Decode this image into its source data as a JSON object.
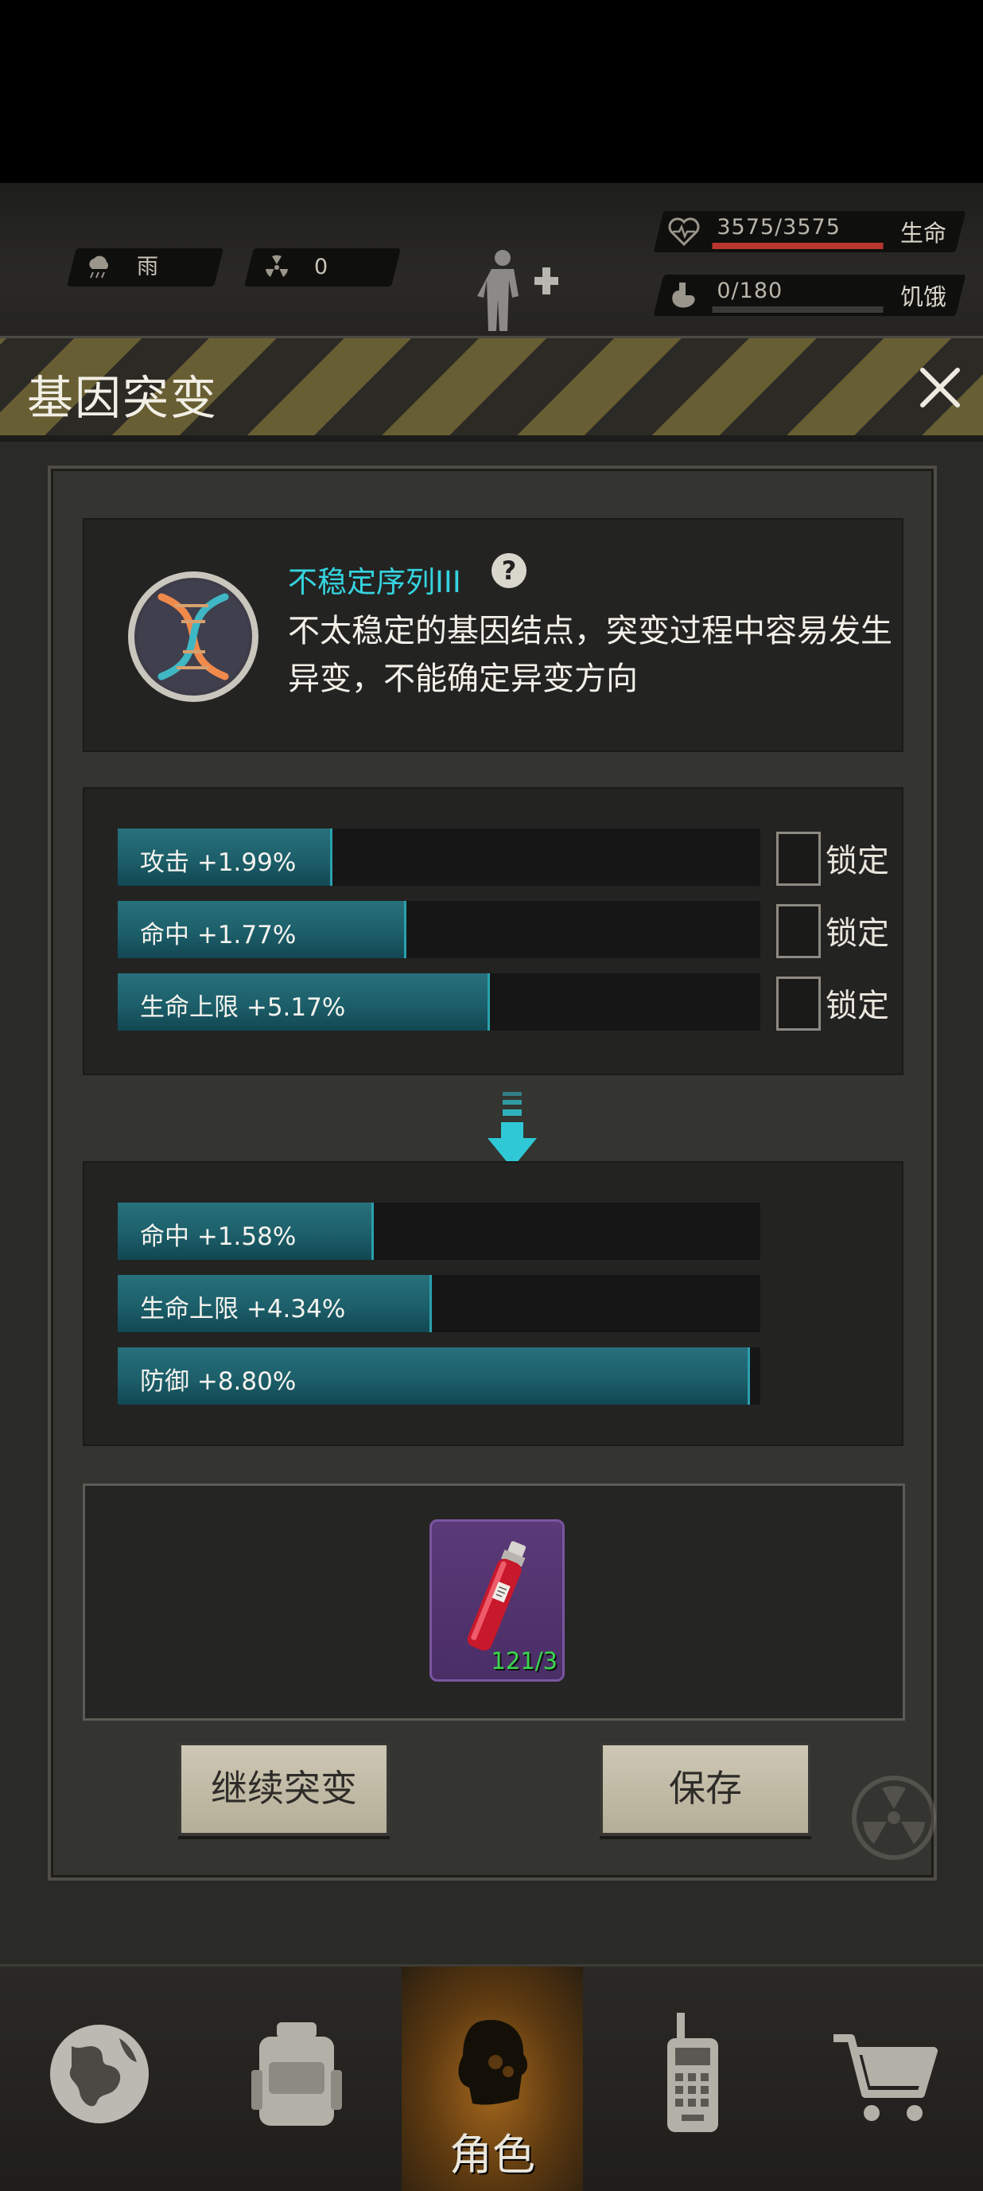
{
  "status": {
    "weather": {
      "icon": "rain-cloud-icon",
      "label": "雨"
    },
    "radiation": {
      "icon": "radiation-icon",
      "value": "0"
    },
    "hp": {
      "value": "3575/3575",
      "label": "生命",
      "fill": 1.0
    },
    "hunger": {
      "value": "0/180",
      "label": "饥饿",
      "fill": 0.0
    }
  },
  "modal": {
    "title": "基因突变",
    "gene": {
      "name": "不稳定序列III",
      "description": "不太稳定的基因结点，突变过程中容易发生异变，不能确定异变方向"
    },
    "current_stats": [
      {
        "label": "攻击 +1.99%",
        "fill": 0.33,
        "lock_label": "锁定",
        "locked": false
      },
      {
        "label": "命中 +1.77%",
        "fill": 0.445,
        "lock_label": "锁定",
        "locked": false
      },
      {
        "label": "生命上限 +5.17%",
        "fill": 0.575,
        "lock_label": "锁定",
        "locked": false
      }
    ],
    "result_stats": [
      {
        "label": "命中 +1.58%",
        "fill": 0.395
      },
      {
        "label": "生命上限 +4.34%",
        "fill": 0.485
      },
      {
        "label": "防御 +8.80%",
        "fill": 0.98
      }
    ],
    "item": {
      "icon": "red-serum-vial-icon",
      "count": "121/3"
    },
    "buttons": {
      "continue": "继续突变",
      "save": "保存"
    }
  },
  "nav": {
    "items": [
      {
        "icon": "globe-icon",
        "label": ""
      },
      {
        "icon": "backpack-icon",
        "label": ""
      },
      {
        "icon": "character-head-icon",
        "label": "角色",
        "active": true
      },
      {
        "icon": "walkie-talkie-icon",
        "label": ""
      },
      {
        "icon": "shopping-cart-icon",
        "label": ""
      }
    ]
  },
  "colors": {
    "accent_cyan": "#35d4e0",
    "bar_teal": "#1c5f6a",
    "hp_red": "#b8362e",
    "potion_purple": "#4a2e66",
    "count_green": "#39d84a"
  }
}
